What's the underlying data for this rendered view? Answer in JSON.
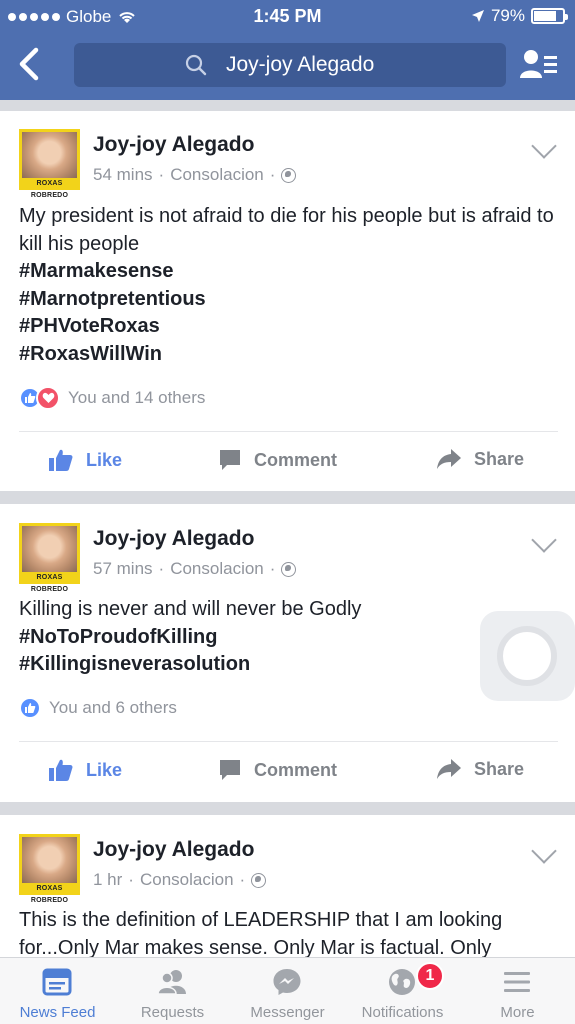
{
  "status_bar": {
    "carrier": "Globe",
    "time": "1:45 PM",
    "battery": "79%",
    "battery_level": 0.79
  },
  "header": {
    "search_text": "Joy-joy Alegado"
  },
  "posts": [
    {
      "author": "Joy-joy Alegado",
      "time": "54 mins",
      "location": "Consolacion",
      "avatar_banner": "ROXAS ROBREDO",
      "body": "My president is not afraid to die for his people but is afraid to kill his people",
      "hashtags": [
        "#Marmakesense",
        "#Marnotpretentious",
        "#PHVoteRoxas",
        "#RoxasWillWin"
      ],
      "reactions": "You and 14 others",
      "reaction_types": [
        "like",
        "love"
      ]
    },
    {
      "author": "Joy-joy Alegado",
      "time": "57 mins",
      "location": "Consolacion",
      "avatar_banner": "ROXAS ROBREDO",
      "body": "Killing is never and will never be Godly",
      "hashtags": [
        "#NoToProudofKilling",
        "#Killingisneverasolution"
      ],
      "reactions": "You and 6 others",
      "reaction_types": [
        "like"
      ]
    },
    {
      "author": "Joy-joy Alegado",
      "time": "1 hr",
      "location": "Consolacion",
      "avatar_banner": "ROXAS ROBREDO",
      "body": "This is the definition of LEADERSHIP that I am looking for...Only Mar makes sense.  Only Mar is factual. Only"
    }
  ],
  "actions": {
    "like": "Like",
    "comment": "Comment",
    "share": "Share"
  },
  "tabs": [
    {
      "label": "News Feed",
      "icon": "news-feed-icon",
      "active": true
    },
    {
      "label": "Requests",
      "icon": "requests-icon"
    },
    {
      "label": "Messenger",
      "icon": "messenger-icon"
    },
    {
      "label": "Notifications",
      "icon": "globe-icon",
      "badge": "1"
    },
    {
      "label": "More",
      "icon": "menu-icon"
    }
  ],
  "colors": {
    "brand": "#4e6fb0",
    "like_blue": "#5b86e5",
    "badge_red": "#f02849"
  }
}
